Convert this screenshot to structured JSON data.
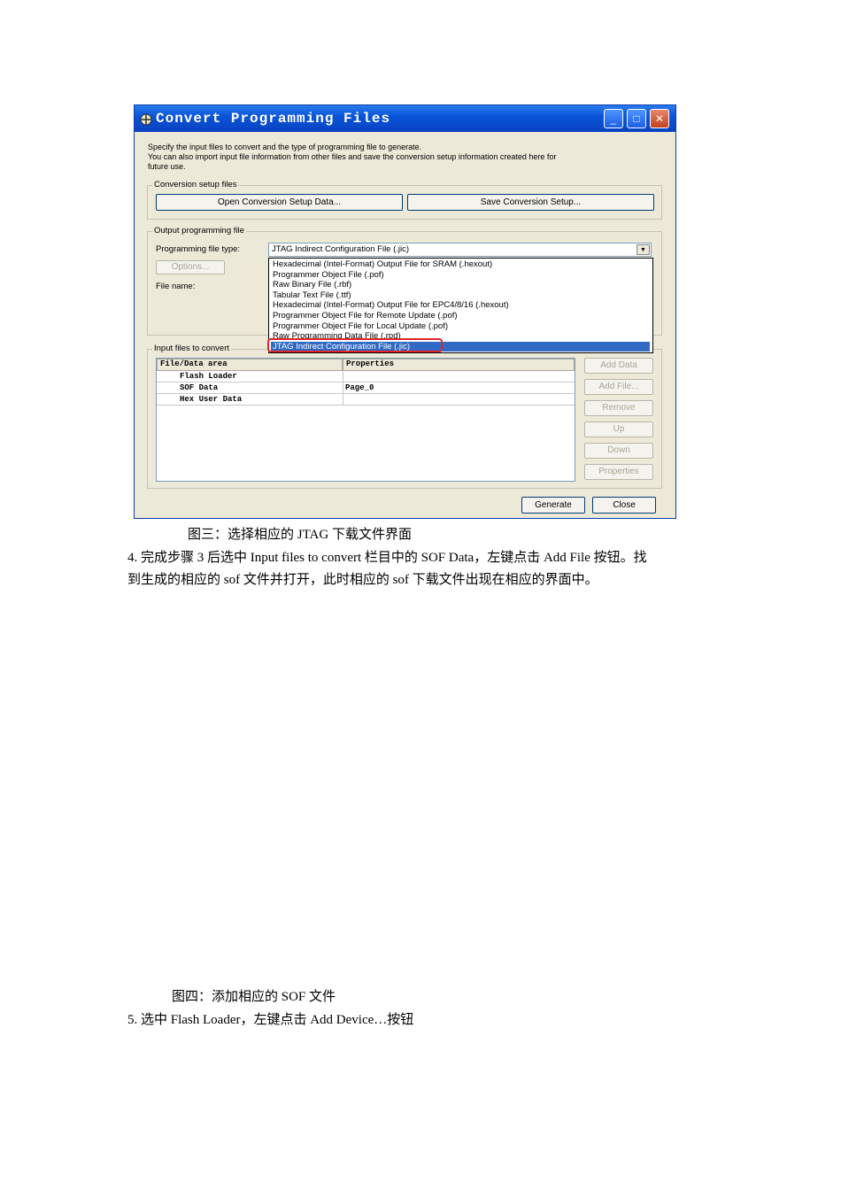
{
  "window": {
    "title": "Convert Programming Files",
    "description_lines": [
      "Specify the input files to convert and the type of programming file to generate.",
      "You can also import input file information from other files and save the conversion setup information created here for",
      "future use."
    ],
    "controls": {
      "minimize": "_",
      "maximize": "□",
      "close": "✕"
    }
  },
  "conversion_setup": {
    "legend": "Conversion setup files",
    "open_button": "Open Conversion Setup Data...",
    "save_button": "Save Conversion Setup..."
  },
  "output": {
    "legend": "Output programming file",
    "file_type_label": "Programming file type:",
    "file_type_value": "JTAG Indirect Configuration File (.jic)",
    "options_button": "Options...",
    "file_name_label": "File name:",
    "dropdown_items": [
      "Hexadecimal (Intel-Format) Output File for SRAM (.hexout)",
      "Programmer Object File (.pof)",
      "Raw Binary File (.rbf)",
      "Tabular Text File (.ttf)",
      "Hexadecimal (Intel-Format) Output File for EPC4/8/16 (.hexout)",
      "Programmer Object File for Remote Update (.pof)",
      "Programmer Object File for Local Update (.pof)",
      "Raw Programming Data File (.rpd)",
      "JTAG Indirect Configuration File (.jic)"
    ],
    "selected_index": 8
  },
  "input": {
    "legend": "Input files to convert",
    "columns": [
      "File/Data area",
      "Properties"
    ],
    "rows": [
      {
        "name": "Flash Loader",
        "props": ""
      },
      {
        "name": "SOF Data",
        "props": "Page_0"
      },
      {
        "name": "Hex User Data",
        "props": ""
      }
    ],
    "buttons": {
      "add_data": "Add Data",
      "add_file": "Add File...",
      "remove": "Remove",
      "up": "Up",
      "down": "Down",
      "properties": "Properties"
    }
  },
  "footer": {
    "generate": "Generate",
    "close": "Close"
  },
  "doc": {
    "caption3": "图三：选择相应的 JTAG 下载文件界面",
    "step4_line1": "4.  完成步骤 3 后选中 Input files to convert 栏目中的 SOF Data，左键点击 Add File 按钮。找",
    "step4_line2": "到生成的相应的 sof 文件并打开，此时相应的 sof 下载文件出现在相应的界面中。",
    "caption4": "图四：添加相应的 SOF 文件",
    "step5": "5.  选中 Flash Loader，左键点击 Add Device…按钮"
  }
}
